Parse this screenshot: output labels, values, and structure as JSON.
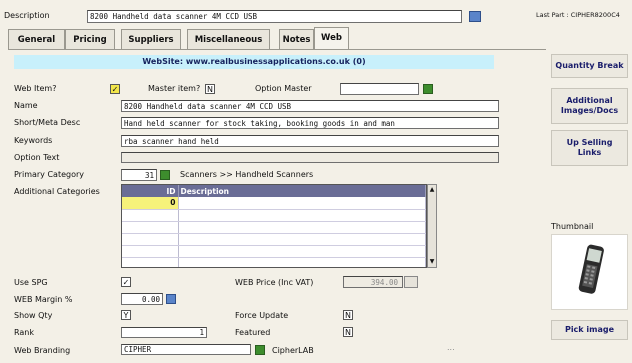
{
  "header": {
    "description_label": "Description",
    "description_value": "8200 Handheld data scanner 4M CCD USB",
    "last_part": "Last Part : CIPHER8200C4"
  },
  "tabs": [
    {
      "label": "General"
    },
    {
      "label": "Pricing"
    },
    {
      "label": "Suppliers"
    },
    {
      "label": "Miscellaneous"
    },
    {
      "label": "Notes"
    },
    {
      "label": "Web"
    }
  ],
  "website_banner": "WebSite: www.realbusinessapplications.co.uk (0)",
  "form": {
    "web_item_label": "Web Item?",
    "web_item_value": "✓",
    "master_item_label": "Master item?",
    "master_item_value": "N",
    "option_master_label": "Option Master",
    "name_label": "Name",
    "name_value": "8200 Handheld data scanner 4M CCD USB",
    "short_desc_label": "Short/Meta Desc",
    "short_desc_value": "Hand held scanner for stock taking, booking goods in and man",
    "keywords_label": "Keywords",
    "keywords_value": "rba scanner hand held",
    "option_text_label": "Option Text",
    "primary_category_label": "Primary Category",
    "primary_category_id": "31",
    "primary_category_path": "Scanners >> Handheld Scanners",
    "additional_categories_label": "Additional Categories",
    "grid_headers": [
      "ID",
      "Description"
    ],
    "grid_first_id": "0",
    "use_spg_label": "Use SPG",
    "use_spg_value": "✓",
    "web_price_label": "WEB Price (Inc VAT)",
    "web_price_value": "394.00",
    "web_margin_label": "WEB Margin %",
    "web_margin_value": "0.00",
    "show_qty_label": "Show Qty",
    "show_qty_value": "Y",
    "force_update_label": "Force Update",
    "force_update_value": "N",
    "rank_label": "Rank",
    "rank_value": "1",
    "featured_label": "Featured",
    "featured_value": "N",
    "web_branding_label": "Web Branding",
    "web_branding_value": "CIPHER",
    "web_branding_name": "CipherLAB",
    "ellipsis": "..."
  },
  "sidebar": {
    "quantity_break": "Quantity Break",
    "additional_images": "Additional Images/Docs",
    "up_selling": "Up Selling Links",
    "thumbnail_label": "Thumbnail",
    "pick_image": "Pick image"
  },
  "colors": {
    "banner": "#c8f0fb",
    "grid_header": "#6a6d96",
    "selected_cell": "#f6f27a"
  }
}
